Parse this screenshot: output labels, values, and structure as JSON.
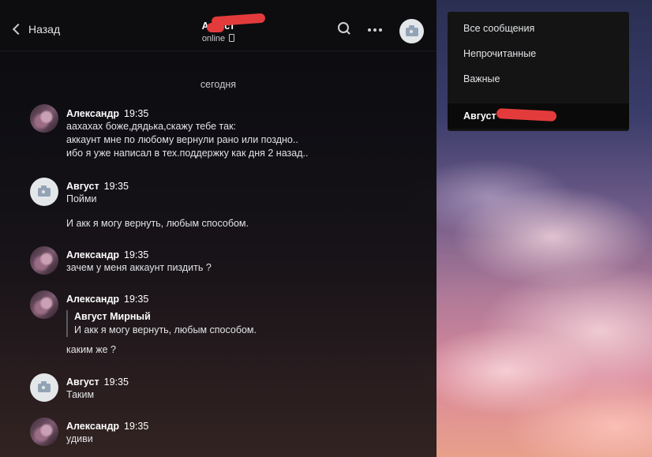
{
  "header": {
    "back_label": "Назад",
    "title": "Август",
    "status": "online"
  },
  "day_divider": "сегодня",
  "messages": [
    {
      "author": "Александр",
      "time": "19:35",
      "lines": [
        "аахахах боже,дядька,скажу тебе так:",
        "аккаунт мне по любому вернули рано или поздно..",
        "ибо я уже написал в тех.поддержку как дня 2 назад.."
      ]
    },
    {
      "author": "Август",
      "time": "19:35",
      "lines": [
        "Пойми",
        "И акк я могу вернуть, любым способом."
      ]
    },
    {
      "author": "Александр",
      "time": "19:35",
      "lines": [
        "зачем у меня аккаунт пиздить ?"
      ]
    },
    {
      "author": "Александр",
      "time": "19:35",
      "reply_author": "Август Мирный",
      "reply_text": "И акк я могу вернуть, любым способом.",
      "lines": [
        "каким же ?"
      ]
    },
    {
      "author": "Август",
      "time": "19:35",
      "lines": [
        "Таким"
      ]
    },
    {
      "author": "Александр",
      "time": "19:35",
      "lines": [
        "удиви"
      ]
    }
  ],
  "menu": {
    "items": [
      "Все сообщения",
      "Непрочитанные",
      "Важные"
    ],
    "active_chat": "Август"
  },
  "colors": {
    "redaction": "#e33b3b",
    "panel_bg": "#0d0d0f",
    "menu_bg": "#141414"
  }
}
